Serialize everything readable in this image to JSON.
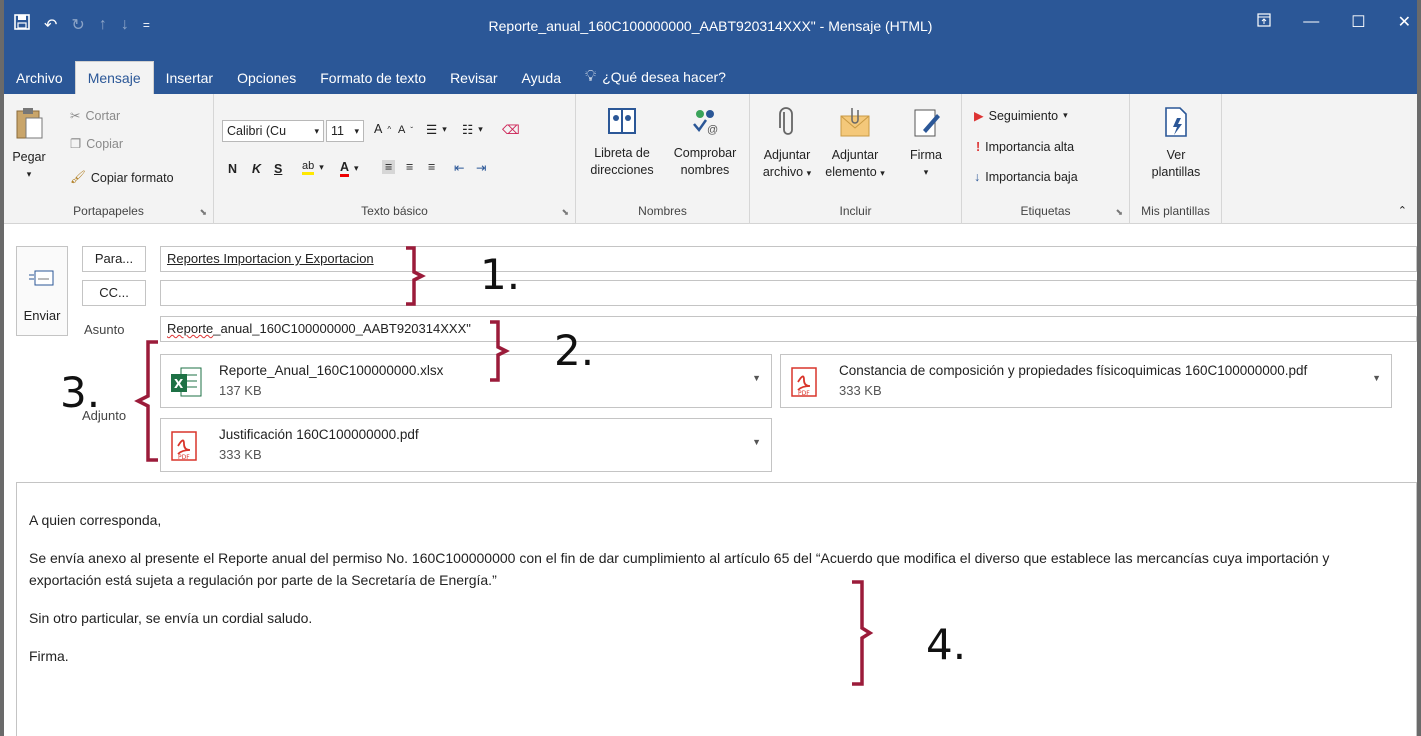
{
  "window": {
    "title": "Reporte_anual_160C100000000_AABT920314XXX\" - Mensaje (HTML)"
  },
  "ribbon_tabs": [
    "Archivo",
    "Mensaje",
    "Insertar",
    "Opciones",
    "Formato de texto",
    "Revisar",
    "Ayuda"
  ],
  "search": {
    "label": "¿Qué desea hacer?"
  },
  "clipboard": {
    "paste": "Pegar",
    "cut": "Cortar",
    "copy": "Copiar",
    "format_painter": "Copiar formato",
    "group_label": "Portapapeles"
  },
  "basic_text": {
    "font_name": "Calibri (Cu",
    "font_size": "11",
    "bold": "N",
    "italic": "K",
    "underline": "S",
    "group_label": "Texto básico"
  },
  "names": {
    "address_book": "Libreta de",
    "address_book_2": "direcciones",
    "check_names": "Comprobar",
    "check_names_2": "nombres",
    "group_label": "Nombres"
  },
  "include": {
    "attach_file": "Adjuntar",
    "attach_file_2": "archivo",
    "attach_item": "Adjuntar",
    "attach_item_2": "elemento",
    "signature": "Firma",
    "group_label": "Incluir"
  },
  "tags": {
    "follow_up": "Seguimiento",
    "high_importance": "Importancia alta",
    "low_importance": "Importancia baja",
    "group_label": "Etiquetas"
  },
  "templates": {
    "view": "Ver",
    "view_2": "plantillas",
    "group_label": "Mis plantillas"
  },
  "compose": {
    "send": "Enviar",
    "to_button": "Para...",
    "cc_button": "CC...",
    "subject_label": "Asunto",
    "attach_label": "Adjunto",
    "to_value": "Reportes Importacion y Exportacion",
    "cc_value": "",
    "subject_prefix": "Reporte",
    "subject_rest": "_anual_160C100000000_AABT920314XXX\""
  },
  "attachments": [
    {
      "name": "Reporte_Anual_160C100000000.xlsx",
      "size": "137 KB",
      "icon": "excel-icon"
    },
    {
      "name": "Constancia de composición y propiedades físicoquimicas 160C100000000.pdf",
      "size": "333 KB",
      "icon": "pdf-icon"
    },
    {
      "name": "Justificación 160C100000000.pdf",
      "size": "333 KB",
      "icon": "pdf-icon"
    }
  ],
  "body": {
    "greeting": "A quien corresponda,",
    "paragraph": "Se envía anexo al presente el Reporte anual del permiso No. 160C100000000  con el fin de dar cumplimiento al artículo 65 del “Acuerdo que modifica el diverso que establece las mercancías cuya importación y exportación está sujeta a regulación por parte de la Secretaría de Energía.”",
    "closing": "Sin otro particular, se envía un cordial saludo.",
    "signature": "Firma."
  },
  "annotations": [
    "1.",
    "2.",
    "3.",
    "4."
  ],
  "colors": {
    "title_bar": "#2b5797",
    "bracket": "#9b1b3a",
    "excel": "#1e7145",
    "pdf": "#d9352b"
  }
}
